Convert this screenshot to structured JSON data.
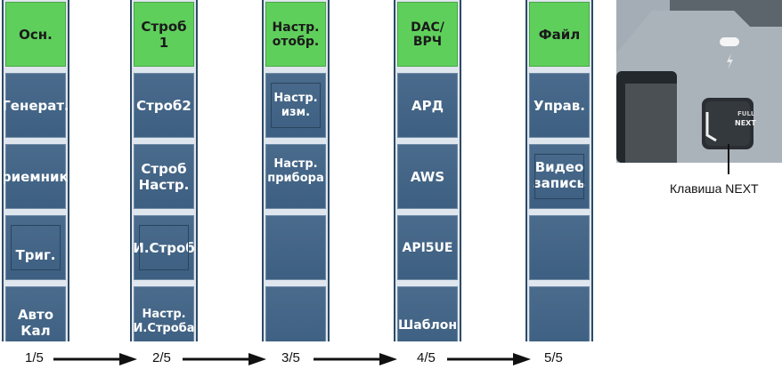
{
  "panels": [
    {
      "page": "1/5",
      "buttons": [
        {
          "label": "Осн.",
          "style": "green"
        },
        {
          "label": "Генерат.",
          "style": "blue"
        },
        {
          "label": "Приемник",
          "style": "blue"
        },
        {
          "label": "Триг.",
          "style": "blue"
        },
        {
          "label": "Авто\nКал",
          "style": "blue"
        }
      ]
    },
    {
      "page": "2/5",
      "buttons": [
        {
          "label": "Строб 1",
          "style": "green"
        },
        {
          "label": "Строб2",
          "style": "blue"
        },
        {
          "label": "Строб\nНастр.",
          "style": "blue"
        },
        {
          "label": "И.Строб",
          "style": "blue"
        },
        {
          "label": "Настр.\nИ.Строба",
          "style": "blue"
        }
      ]
    },
    {
      "page": "3/5",
      "buttons": [
        {
          "label": "Настр.\nотобр.",
          "style": "green"
        },
        {
          "label": "Настр.\nизм.",
          "style": "blue"
        },
        {
          "label": "Настр.\nприбора",
          "style": "blue"
        },
        {
          "label": "",
          "style": "blue"
        },
        {
          "label": "",
          "style": "blue"
        }
      ]
    },
    {
      "page": "4/5",
      "buttons": [
        {
          "label": "DAC/\nВРЧ",
          "style": "green"
        },
        {
          "label": "АРД",
          "style": "blue"
        },
        {
          "label": "AWS",
          "style": "blue"
        },
        {
          "label": "API5UE",
          "style": "blue"
        },
        {
          "label": "Шаблон",
          "style": "blue"
        }
      ]
    },
    {
      "page": "5/5",
      "buttons": [
        {
          "label": "Файл",
          "style": "green"
        },
        {
          "label": "Управ.",
          "style": "blue"
        },
        {
          "label": "Видео\nзапись",
          "style": "blue"
        },
        {
          "label": "",
          "style": "blue"
        },
        {
          "label": "",
          "style": "blue"
        }
      ]
    }
  ],
  "device": {
    "key_top_label": "FULL",
    "key_bottom_label": "NEXT",
    "callout": "Клавиша NEXT"
  },
  "colors": {
    "selected": "#5fcf5c",
    "button": "#3d5f81",
    "frame": "#2e4a66"
  }
}
